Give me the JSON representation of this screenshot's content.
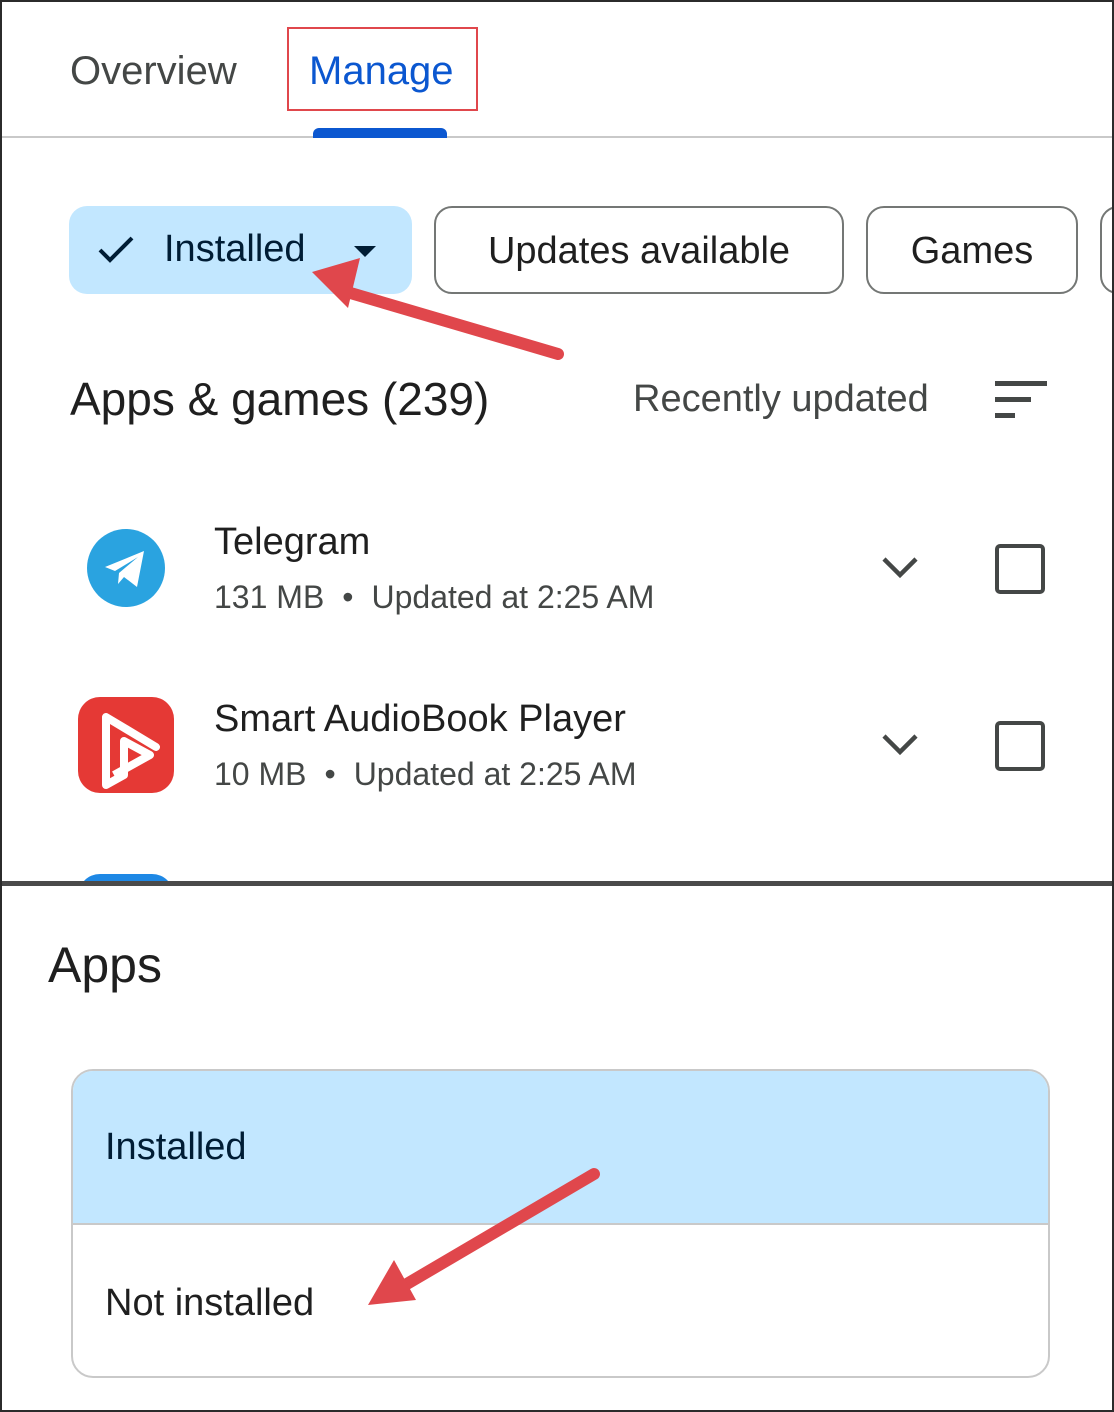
{
  "tabs": [
    {
      "label": "Overview"
    },
    {
      "label": "Manage"
    }
  ],
  "filters": {
    "installed": "Installed",
    "updates": "Updates available",
    "games": "Games"
  },
  "section": {
    "title": "Apps & games (239)",
    "sort_label": "Recently updated"
  },
  "apps": [
    {
      "name": "Telegram",
      "size": "131 MB",
      "updated": "Updated at 2:25 AM",
      "icon": "telegram-icon"
    },
    {
      "name": "Smart AudioBook Player",
      "size": "10 MB",
      "updated": "Updated at 2:25 AM",
      "icon": "audiobook-icon"
    }
  ],
  "separator": "•",
  "sheet": {
    "title": "Apps",
    "options": [
      {
        "label": "Installed",
        "selected": true
      },
      {
        "label": "Not installed",
        "selected": false
      }
    ]
  },
  "colors": {
    "accent": "#0b57d0",
    "chip_selected": "#c2e7ff",
    "annotation": "#e0474c"
  }
}
